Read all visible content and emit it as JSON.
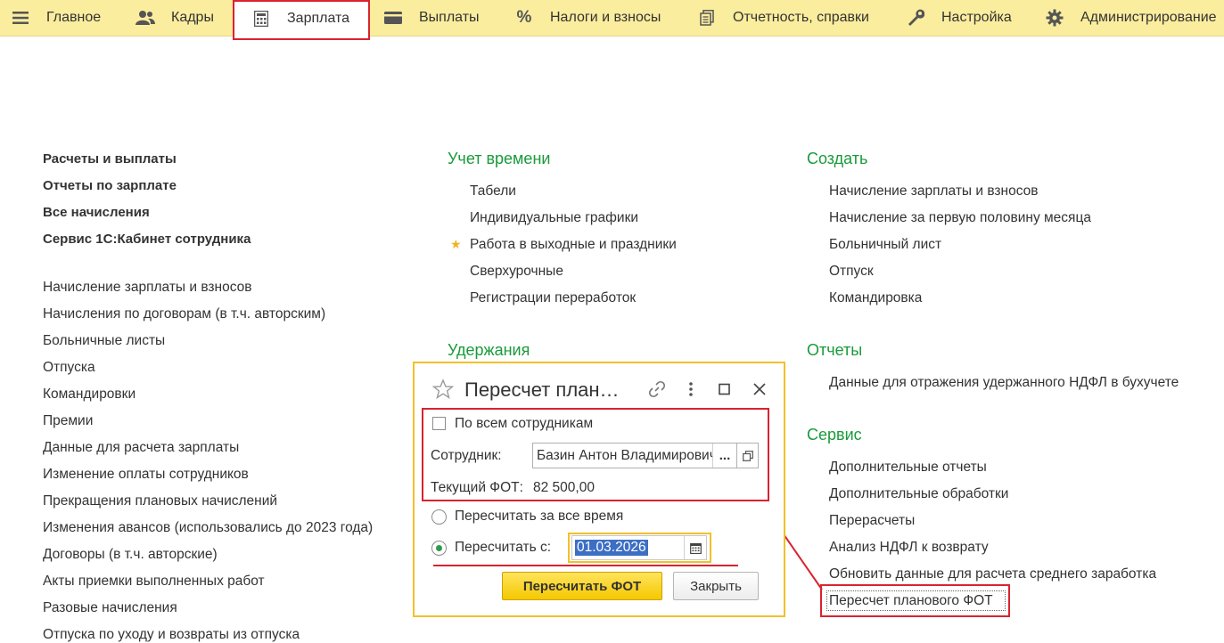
{
  "nav": {
    "items": [
      {
        "label": "Главное",
        "icon": "hamburger-menu-icon"
      },
      {
        "label": "Кадры",
        "icon": "people-icon"
      },
      {
        "label": "Зарплата",
        "icon": "calculator-icon"
      },
      {
        "label": "Выплаты",
        "icon": "wallet-icon"
      },
      {
        "label": "Налоги и взносы",
        "icon": "percent-icon"
      },
      {
        "label": "Отчетность, справки",
        "icon": "documents-icon"
      },
      {
        "label": "Настройка",
        "icon": "wrench-icon"
      },
      {
        "label": "Администрирование",
        "icon": "gear-icon"
      }
    ],
    "active": "Зарплата"
  },
  "left_column": {
    "bold_links": [
      "Расчеты и выплаты",
      "Отчеты по зарплате",
      "Все начисления",
      "Сервис 1С:Кабинет сотрудника"
    ],
    "links": [
      "Начисление зарплаты и взносов",
      "Начисления по договорам (в т.ч. авторским)",
      "Больничные листы",
      "Отпуска",
      "Командировки",
      "Премии",
      "Данные для расчета зарплаты",
      "Изменение оплаты сотрудников",
      "Прекращения плановых начислений",
      "Изменения авансов (использовались до 2023 года)",
      "Договоры (в т.ч. авторские)",
      "Акты приемки выполненных работ",
      "Разовые начисления",
      "Отпуска по уходу и возвраты из отпуска"
    ]
  },
  "middle_column": {
    "time_title": "Учет времени",
    "time_links": [
      "Табели",
      "Индивидуальные графики",
      "Работа в выходные и праздники",
      "Сверхурочные",
      "Регистрации переработок"
    ],
    "deductions_title": "Удержания"
  },
  "right_column": {
    "create_title": "Создать",
    "create_links": [
      "Начисление зарплаты и взносов",
      "Начисление за первую половину месяца",
      "Больничный лист",
      "Отпуск",
      "Командировка"
    ],
    "reports_title": "Отчеты",
    "reports_links": [
      "Данные для отражения удержанного НДФЛ в бухучете"
    ],
    "service_title": "Сервис",
    "service_links": [
      "Дополнительные отчеты",
      "Дополнительные обработки",
      "Перерасчеты",
      "Анализ НДФЛ к возврату",
      "Обновить данные для расчета среднего заработка",
      "Пересчет планового ФОТ"
    ]
  },
  "dialog": {
    "title": "Пересчет план…",
    "all_employees_label": "По всем сотрудникам",
    "employee_label": "Сотрудник:",
    "employee_value": "Базин Антон Владимирович",
    "select_button": "...",
    "current_fot_label": "Текущий ФОТ:",
    "current_fot_value": "82 500,00",
    "recalc_all_label": "Пересчитать за все время",
    "recalc_from_label": "Пересчитать с:",
    "recalc_from_date": "01.03.2026",
    "recalc_button": "Пересчитать ФОТ",
    "close_button": "Закрыть"
  }
}
